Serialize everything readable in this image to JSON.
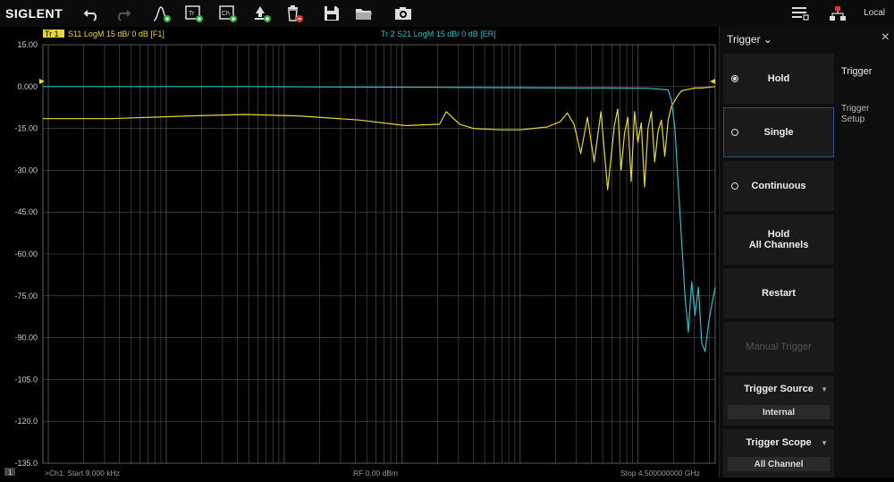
{
  "toolbar": {
    "logo": "SIGLENT",
    "status": "Local",
    "icons": [
      "undo-icon",
      "redo-icon",
      "marker-add-icon",
      "trace-add-icon",
      "channel-add-icon",
      "window-add-icon",
      "delete-icon",
      "save-icon",
      "open-folder-icon",
      "camera-icon",
      "menu-icon",
      "network-icon"
    ]
  },
  "plot": {
    "tr1_tag": "Tr 1",
    "tr1_desc": "S11 LogM 15 dB/ 0 dB [F1]",
    "tr2_desc": "Tr 2  S21 LogM 15 dB/ 0 dB [ER]",
    "yticks": [
      "15.00",
      "0.000",
      "-15.00",
      "-30.00",
      "-45.00",
      "-60.00",
      "-75.00",
      "-90.00",
      "-105.0",
      "-120.0",
      "-135.0"
    ],
    "footer_ch": "1",
    "footer_start": ">Ch1: Start 9.000 kHz",
    "footer_rf": "RF 0.00 dBm",
    "footer_stop": "Stop 4.500000000 GHz",
    "colors": {
      "tr1": "#e6d836",
      "tr2": "#31bcc6",
      "grid": "#555555"
    }
  },
  "chart_data": {
    "type": "line",
    "title": "",
    "xlabel": "",
    "ylabel": "",
    "x_scale": "log",
    "x_range_hz": [
      9000,
      4500000000
    ],
    "ylim": [
      -135,
      15
    ],
    "y_div": 15,
    "grid": true,
    "series": [
      {
        "name": "S11",
        "x_frac": [
          0,
          0.1,
          0.22,
          0.3,
          0.38,
          0.47,
          0.54,
          0.59,
          0.6,
          0.62,
          0.64,
          0.68,
          0.71,
          0.75,
          0.77,
          0.78,
          0.79,
          0.8,
          0.81,
          0.82,
          0.83,
          0.84,
          0.85,
          0.855,
          0.86,
          0.865,
          0.87,
          0.875,
          0.88,
          0.885,
          0.89,
          0.895,
          0.9,
          0.905,
          0.91,
          0.915,
          0.92,
          0.925,
          0.93,
          0.935,
          0.94,
          0.945,
          0.95,
          0.96,
          0.97,
          0.98,
          1.0
        ],
        "y_db": [
          -11.5,
          -11.5,
          -10.5,
          -10.0,
          -10.5,
          -12.0,
          -14.0,
          -13.5,
          -9.0,
          -13.5,
          -15.0,
          -15.5,
          -15.5,
          -14.5,
          -12.5,
          -9.5,
          -13.5,
          -24.0,
          -11.0,
          -27.0,
          -9.0,
          -37.0,
          -14.0,
          -8.0,
          -30.0,
          -17.0,
          -11.0,
          -34.0,
          -9.0,
          -20.0,
          -13.0,
          -36.0,
          -15.0,
          -9.0,
          -27.0,
          -16.0,
          -12.0,
          -25.0,
          -12.0,
          -7.0,
          -5.0,
          -3.0,
          -1.5,
          -1.0,
          -0.5,
          -0.5,
          0.0
        ]
      },
      {
        "name": "S21",
        "x_frac": [
          0,
          0.3,
          0.6,
          0.78,
          0.84,
          0.9,
          0.93,
          0.935,
          0.94,
          0.945,
          0.95,
          0.955,
          0.96,
          0.965,
          0.97,
          0.975,
          0.98,
          0.985,
          0.99,
          0.995,
          1.0
        ],
        "y_db": [
          0.0,
          0.0,
          -0.3,
          -0.5,
          -0.5,
          -0.6,
          -1.2,
          -5.0,
          -15.0,
          -35.0,
          -55.0,
          -75.0,
          -88.0,
          -70.0,
          -82.0,
          -72.0,
          -92.0,
          -95.0,
          -85.0,
          -78.0,
          -72.0
        ]
      }
    ]
  },
  "panel": {
    "title": "Trigger",
    "buttons": {
      "hold": "Hold",
      "single": "Single",
      "continuous": "Continuous",
      "hold_all_1": "Hold",
      "hold_all_2": "All Channels",
      "restart": "Restart",
      "manual": "Manual Trigger"
    },
    "source_label": "Trigger Source",
    "source_value": "Internal",
    "scope_label": "Trigger Scope",
    "scope_value": "All Channel",
    "side_tabs": [
      "Trigger",
      "Trigger",
      "Setup"
    ]
  }
}
